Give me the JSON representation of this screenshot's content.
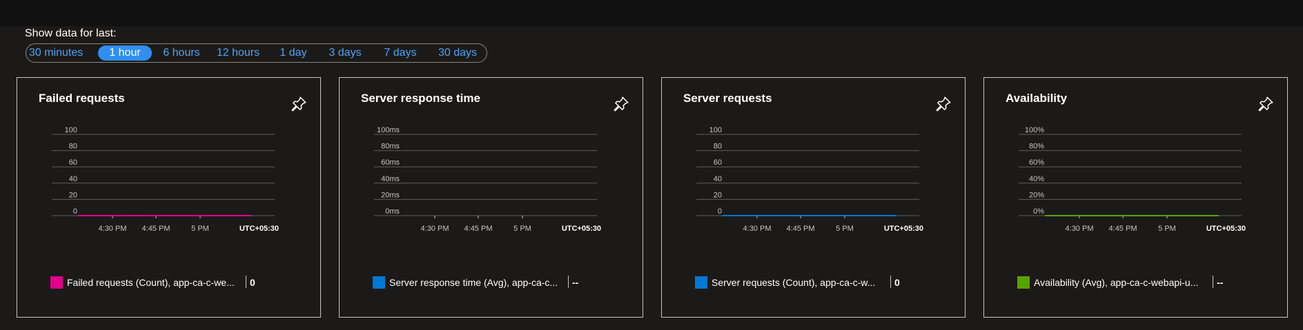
{
  "time_range": {
    "label": "Show data for last:",
    "options": [
      "30 minutes",
      "1 hour",
      "6 hours",
      "12 hours",
      "1 day",
      "3 days",
      "7 days",
      "30 days"
    ],
    "selected": "1 hour"
  },
  "timezone_label": "UTC+05:30",
  "icons": {
    "pin": "pin-icon"
  },
  "cards": [
    {
      "title": "Failed requests",
      "legend_text": "Failed requests (Count), app-ca-c-we...",
      "legend_value": "0",
      "series_color": "#e3008c"
    },
    {
      "title": "Server response time",
      "legend_text": "Server response time (Avg), app-ca-c...",
      "legend_value": "--",
      "series_color": "#0078d4"
    },
    {
      "title": "Server requests",
      "legend_text": "Server requests (Count), app-ca-c-w...",
      "legend_value": "0",
      "series_color": "#0078d4"
    },
    {
      "title": "Availability",
      "legend_text": "Availability (Avg), app-ca-c-webapi-u...",
      "legend_value": "--",
      "series_color": "#57a300"
    }
  ],
  "chart_data": [
    {
      "type": "line",
      "title": "Failed requests",
      "x_ticks": [
        "4:30 PM",
        "4:45 PM",
        "5 PM"
      ],
      "y_ticks": [
        "100",
        "80",
        "60",
        "40",
        "20",
        "0"
      ],
      "ylim": [
        0,
        100
      ],
      "grid": true,
      "legend_position": "bottom",
      "series": [
        {
          "name": "Failed requests (Count), app-ca-c-we...",
          "color": "#e3008c",
          "values": [
            0,
            0
          ]
        }
      ]
    },
    {
      "type": "line",
      "title": "Server response time",
      "x_ticks": [
        "4:30 PM",
        "4:45 PM",
        "5 PM"
      ],
      "y_ticks": [
        "100ms",
        "80ms",
        "60ms",
        "40ms",
        "20ms",
        "0ms"
      ],
      "ylim": [
        0,
        100
      ],
      "grid": true,
      "legend_position": "bottom",
      "series": [
        {
          "name": "Server response time (Avg), app-ca-c...",
          "color": "#0078d4",
          "values": []
        }
      ]
    },
    {
      "type": "line",
      "title": "Server requests",
      "x_ticks": [
        "4:30 PM",
        "4:45 PM",
        "5 PM"
      ],
      "y_ticks": [
        "100",
        "80",
        "60",
        "40",
        "20",
        "0"
      ],
      "ylim": [
        0,
        100
      ],
      "grid": true,
      "legend_position": "bottom",
      "series": [
        {
          "name": "Server requests (Count), app-ca-c-w...",
          "color": "#0078d4",
          "values": [
            0,
            0
          ]
        }
      ]
    },
    {
      "type": "line",
      "title": "Availability",
      "x_ticks": [
        "4:30 PM",
        "4:45 PM",
        "5 PM"
      ],
      "y_ticks": [
        "100%",
        "80%",
        "60%",
        "40%",
        "20%",
        "0%"
      ],
      "ylim": [
        0,
        100
      ],
      "grid": true,
      "legend_position": "bottom",
      "series": [
        {
          "name": "Availability (Avg), app-ca-c-webapi-u...",
          "color": "#57a300",
          "values": [
            0,
            0
          ]
        }
      ]
    }
  ]
}
